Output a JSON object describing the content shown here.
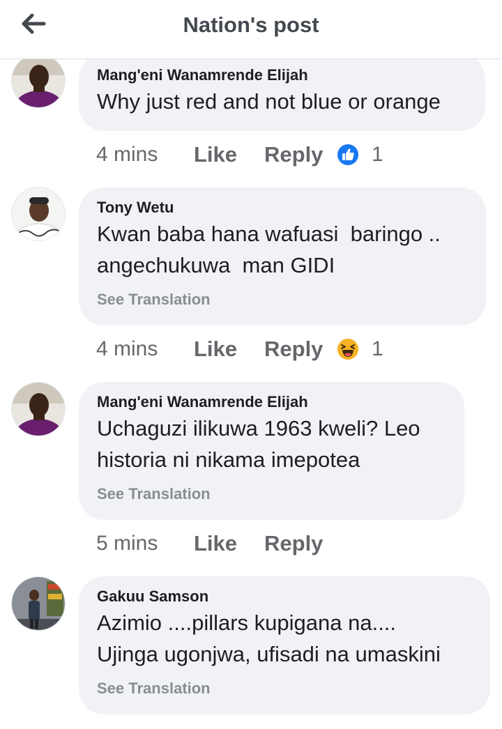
{
  "header": {
    "title": "Nation's post",
    "back_icon": "arrow-left-icon"
  },
  "colors": {
    "bubble_bg": "#f0f2f5",
    "like_blue": "#1877f2",
    "haha_yellow": "#f7b125",
    "meta_gray": "#65676b"
  },
  "comments": [
    {
      "author": "Mang'eni Wanamrende Elijah",
      "text": "Why just red and not blue or orange",
      "time": "4 mins",
      "like_label": "Like",
      "reply_label": "Reply",
      "reaction": "like-icon",
      "reaction_count": "1"
    },
    {
      "author": "Tony Wetu",
      "text": "Kwan baba hana wafuasi  baringo ..\nangechukuwa  man GIDI",
      "see_translation": "See Translation",
      "time": "4 mins",
      "like_label": "Like",
      "reply_label": "Reply",
      "reaction": "haha-icon",
      "reaction_count": "1"
    },
    {
      "author": "Mang'eni Wanamrende Elijah",
      "text": "Uchaguzi ilikuwa 1963 kweli? Leo\nhistoria ni nikama imepotea",
      "see_translation": "See Translation",
      "time": "5 mins",
      "like_label": "Like",
      "reply_label": "Reply"
    },
    {
      "author": "Gakuu Samson",
      "text": "Azimio ....pillars kupigana na....\nUjinga ugonjwa, ufisadi na umaskini",
      "see_translation": "See Translation"
    }
  ]
}
